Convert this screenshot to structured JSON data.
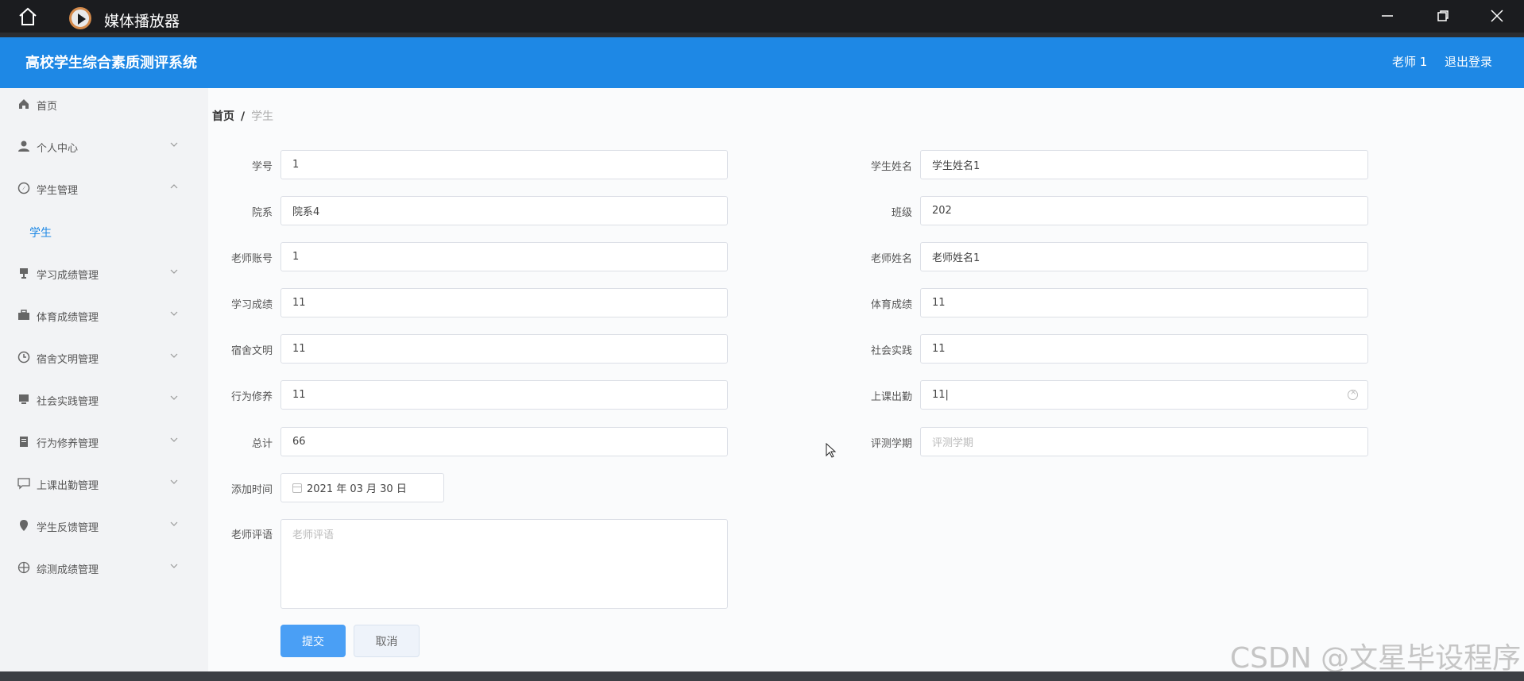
{
  "window": {
    "app_name": "媒体播放器"
  },
  "header": {
    "brand": "高校学生综合素质测评系统",
    "user": "老师 1",
    "logout": "退出登录"
  },
  "sidebar": {
    "items": [
      {
        "label": "首页",
        "icon": "home-icon"
      },
      {
        "label": "个人中心",
        "icon": "user-icon",
        "chevron": "down"
      },
      {
        "label": "学生管理",
        "icon": "compass-icon",
        "chevron": "up"
      },
      {
        "label": "学习成绩管理",
        "icon": "trophy-icon",
        "chevron": "down"
      },
      {
        "label": "体育成绩管理",
        "icon": "briefcase-icon",
        "chevron": "down"
      },
      {
        "label": "宿舍文明管理",
        "icon": "clock-icon",
        "chevron": "down"
      },
      {
        "label": "社会实践管理",
        "icon": "monitor-icon",
        "chevron": "down"
      },
      {
        "label": "行为修养管理",
        "icon": "clipboard-icon",
        "chevron": "down"
      },
      {
        "label": "上课出勤管理",
        "icon": "chat-icon",
        "chevron": "down"
      },
      {
        "label": "学生反馈管理",
        "icon": "location-icon",
        "chevron": "down"
      },
      {
        "label": "综测成绩管理",
        "icon": "target-icon",
        "chevron": "down"
      }
    ],
    "sub_item": "学生"
  },
  "breadcrumb": {
    "home": "首页",
    "sep": "/",
    "current": "学生"
  },
  "form": {
    "student_no": {
      "label": "学号",
      "value": "1"
    },
    "student_name": {
      "label": "学生姓名",
      "value": "学生姓名1"
    },
    "department": {
      "label": "院系",
      "value": "院系4"
    },
    "class": {
      "label": "班级",
      "value": "202"
    },
    "teacher_account": {
      "label": "老师账号",
      "value": "1"
    },
    "teacher_name": {
      "label": "老师姓名",
      "value": "老师姓名1"
    },
    "study_score": {
      "label": "学习成绩",
      "value": "11"
    },
    "sports_score": {
      "label": "体育成绩",
      "value": "11"
    },
    "dorm": {
      "label": "宿舍文明",
      "value": "11"
    },
    "social": {
      "label": "社会实践",
      "value": "11"
    },
    "behavior": {
      "label": "行为修养",
      "value": "11"
    },
    "attendance": {
      "label": "上课出勤",
      "value": "11|"
    },
    "total": {
      "label": "总计",
      "value": "66"
    },
    "semester": {
      "label": "评测学期",
      "placeholder": "评测学期"
    },
    "add_time": {
      "label": "添加时间",
      "value": "2021 年 03 月 30 日"
    },
    "comment": {
      "label": "老师评语",
      "placeholder": "老师评语"
    },
    "submit": "提交",
    "cancel": "取消"
  },
  "watermark": "CSDN @文星毕设程序"
}
